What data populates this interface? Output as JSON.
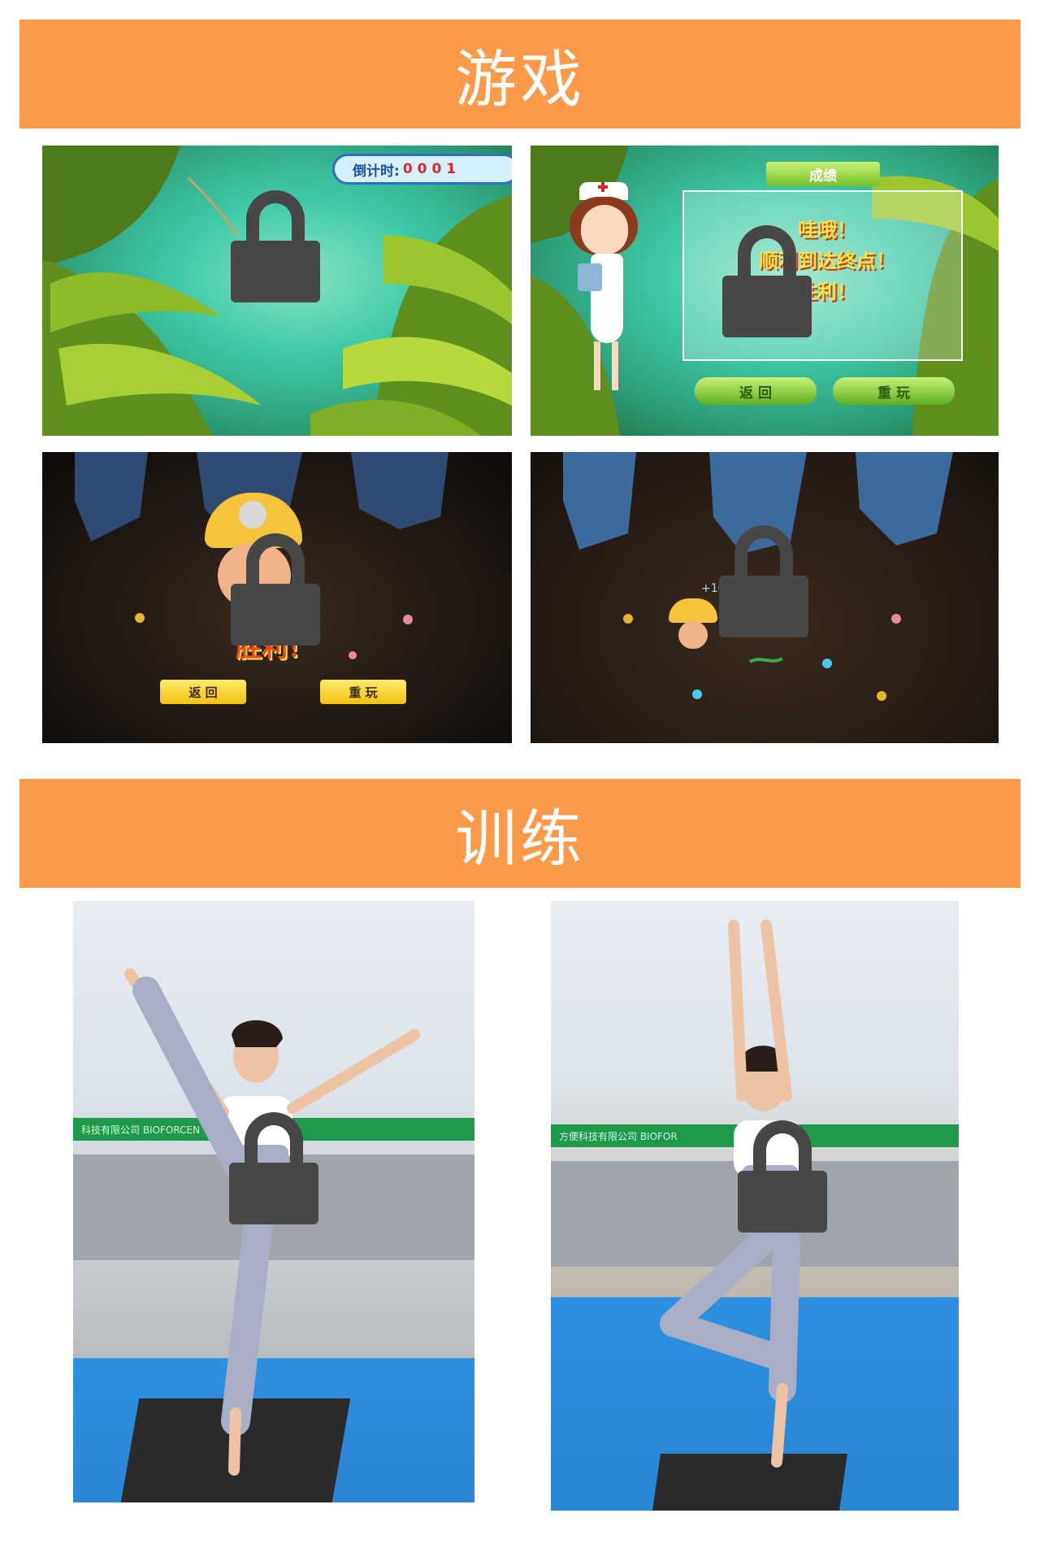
{
  "sections": {
    "games": {
      "title": "游戏"
    },
    "training": {
      "title": "训练"
    }
  },
  "game1": {
    "timer_label": "倒计时:",
    "timer_value": "0001"
  },
  "game2": {
    "panel_title": "成绩",
    "message_lines": [
      "哇哦！",
      "顺利到达终点！",
      "胜利！"
    ],
    "back_button": "返 回",
    "replay_button": "重 玩"
  },
  "game3": {
    "win_text": "胜利！",
    "back_button": "返 回",
    "replay_button": "重 玩"
  },
  "game4": {
    "score_text": "+10"
  },
  "training": {
    "banner_text_1": "科技有限公司 BIOFORCEN",
    "banner_text_2": "方便科技有限公司 BIOFOR"
  },
  "colors": {
    "banner": "#FD9A4A",
    "lock": "#474747",
    "jungle_water": "#3FC9A8",
    "cave_dark": "#1A1410",
    "mat_blue": "#2E8FE0"
  },
  "icons": [
    "lock-icon"
  ]
}
